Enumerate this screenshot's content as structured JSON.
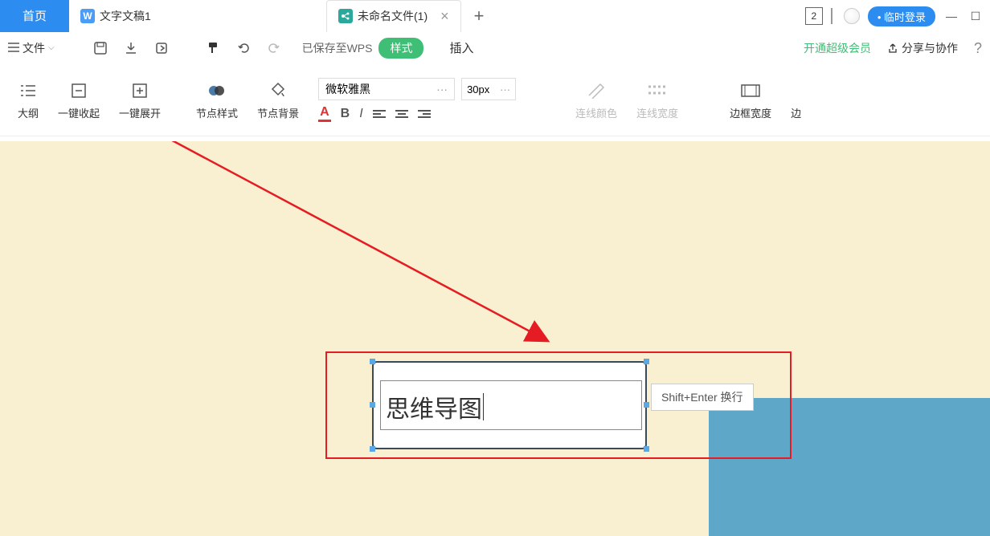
{
  "tabs": {
    "home": "首页",
    "doc1": {
      "icon": "W",
      "label": "文字文稿1"
    },
    "active": {
      "label": "未命名文件(1)"
    },
    "close": "×",
    "plus": "+"
  },
  "titlebar": {
    "badge": "2",
    "login": "• 临时登录",
    "minimize": "—",
    "maximize": "☐"
  },
  "toolbar": {
    "menu": "文件",
    "save_status": "已保存至WPS",
    "style_pill": "样式",
    "insert": "插入",
    "vip": "开通超级会员",
    "share": "分享与协作",
    "help": "?"
  },
  "ribbon": {
    "outline": "大纲",
    "collapse": "一键收起",
    "expand": "一键展开",
    "node_style": "节点样式",
    "node_bg": "节点背景",
    "font_name": "微软雅黑",
    "font_more": "···",
    "font_size": "30px",
    "size_more": "···",
    "A": "A",
    "B": "B",
    "I": "I",
    "line_color": "连线颜色",
    "line_width": "连线宽度",
    "border_width": "边框宽度",
    "border_more": "边"
  },
  "canvas": {
    "node_text": "思维导图",
    "tooltip": "Shift+Enter 换行"
  }
}
